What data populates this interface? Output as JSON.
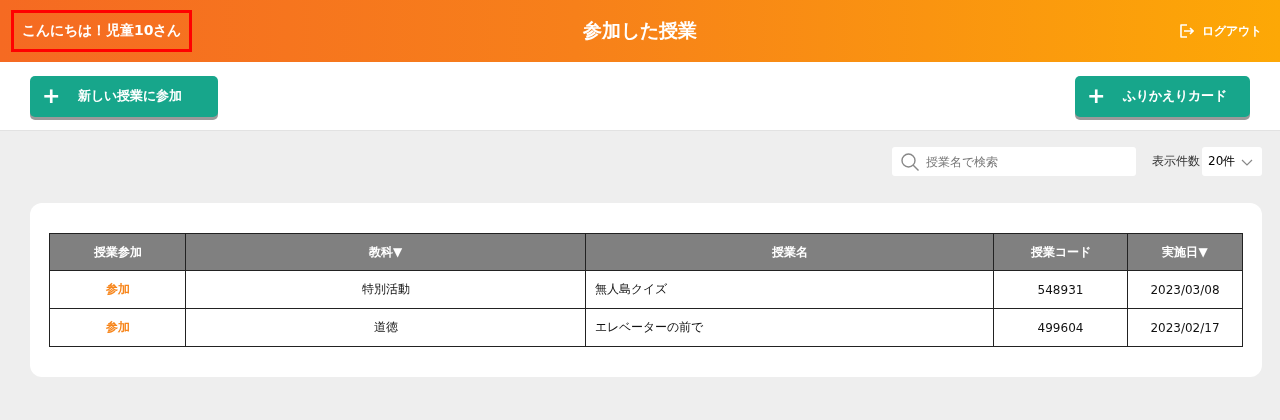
{
  "header": {
    "greeting": "こんにちは！児童10さん",
    "greeting_highlighted": true,
    "title": "参加した授業",
    "logout": "ログアウト"
  },
  "toolbar": {
    "buttons": [
      {
        "label": "新しい授業に参加",
        "icon": "+"
      },
      {
        "label": "ふりかえりカード",
        "icon": "+"
      }
    ]
  },
  "filters": {
    "search": {
      "placeholder": "授業名で検索"
    },
    "page_size_label": "表示件数",
    "page_size": "20件"
  },
  "table": {
    "columns": [
      {
        "label": "授業参加"
      },
      {
        "label": "教科▼"
      },
      {
        "label": "授業名"
      },
      {
        "label": "授業コード"
      },
      {
        "label": "実施日▼"
      }
    ],
    "rows": [
      [
        "参加",
        "特別活動",
        "無人島クイズ",
        "548931",
        "2023/03/08"
      ],
      [
        "参加",
        "道徳",
        "エレベーターの前で",
        "499604",
        "2023/02/17"
      ]
    ]
  }
}
